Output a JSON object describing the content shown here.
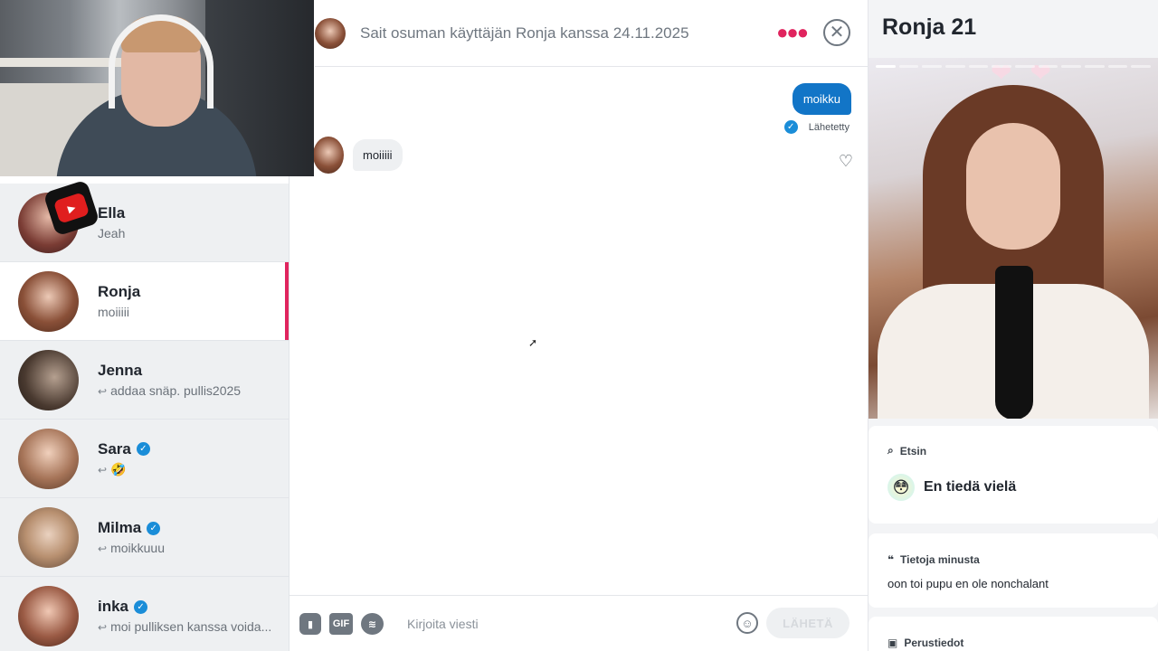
{
  "chat": {
    "header_title": "Sait osuman käyttäjän Ronja kanssa 24.11.2025",
    "more_icon": "more-dots-icon",
    "close_icon": "close-icon",
    "messages": {
      "outgoing_text": "moikku",
      "outgoing_status": "Lähetetty",
      "incoming_text": "moiiiii"
    },
    "composer": {
      "sticker_icon": "sticker-icon",
      "gif_label": "GIF",
      "spotify_icon": "spotify-icon",
      "input_placeholder": "Kirjoita viesti",
      "emoji_icon": "emoji-icon",
      "send_label": "LÄHETÄ"
    }
  },
  "matches": [
    {
      "name": "Ella",
      "preview": "Jeah",
      "reply": false,
      "verified": false,
      "active": false
    },
    {
      "name": "Ronja",
      "preview": "moiiiii",
      "reply": false,
      "verified": false,
      "active": true
    },
    {
      "name": "Jenna",
      "preview": "addaa snäp. pullis2025",
      "reply": true,
      "verified": false,
      "active": false
    },
    {
      "name": "Sara",
      "preview": "🤣",
      "reply": true,
      "verified": true,
      "active": false
    },
    {
      "name": "Milma",
      "preview": "moikkuuu",
      "reply": true,
      "verified": true,
      "active": false
    },
    {
      "name": "inka",
      "preview": "moi pulliksen kanssa voida...",
      "reply": true,
      "verified": true,
      "active": false
    }
  ],
  "profile": {
    "name_age": "Ronja 21",
    "looking_for_label": "Etsin",
    "looking_for_value": "En tiedä vielä",
    "looking_for_emoji": "😳",
    "about_label": "Tietoja minusta",
    "about_text": "oon toi pupu en ole nonchalant",
    "basics_label": "Perustiedot"
  },
  "colors": {
    "accent": "#e0245e",
    "bubble_out": "#1275c7",
    "verified": "#1a8dd8"
  }
}
